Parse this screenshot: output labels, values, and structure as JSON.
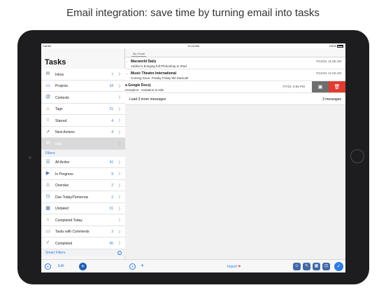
{
  "headline": "Email integration: save time by turning email into tasks",
  "status": {
    "carrier": "Carrier",
    "time": "11:15 AM",
    "battery": "100%"
  },
  "sidebar": {
    "title": "Tasks",
    "items": [
      {
        "label": "Inbox",
        "count": "7",
        "icon": "inbox-icon",
        "glyph": "✉"
      },
      {
        "label": "Projects",
        "count": "34",
        "icon": "folder-icon",
        "glyph": "▭"
      },
      {
        "label": "Contexts",
        "count": "",
        "icon": "at-icon",
        "glyph": "@"
      },
      {
        "label": "Tags",
        "count": "21",
        "icon": "tag-icon",
        "glyph": "⌂"
      },
      {
        "label": "Starred",
        "count": "4",
        "icon": "star-icon",
        "glyph": "☆"
      },
      {
        "label": "Next Actions",
        "count": "4",
        "icon": "arrow-icon",
        "glyph": "➚"
      },
      {
        "label": "Mail",
        "count": "",
        "icon": "mail-icon",
        "glyph": "✉"
      }
    ],
    "filters_header": "Filters",
    "filters": [
      {
        "label": "All Active",
        "count": "41",
        "icon": "all-active-icon",
        "glyph": "☰"
      },
      {
        "label": "In Progress",
        "count": "9",
        "icon": "play-icon",
        "glyph": "▶"
      },
      {
        "label": "Overdue",
        "count": "2",
        "icon": "warning-icon",
        "glyph": "⚠"
      },
      {
        "label": "Due Today/Tomorrow",
        "count": "2",
        "icon": "clock-icon",
        "glyph": "◷"
      },
      {
        "label": "Undated",
        "count": "31",
        "icon": "calendar-icon",
        "glyph": "▦"
      },
      {
        "label": "Completed Today",
        "count": "",
        "icon": "bulb-icon",
        "glyph": "♁"
      },
      {
        "label": "Tasks with Comments",
        "count": "3",
        "icon": "comment-icon",
        "glyph": "▭"
      },
      {
        "label": "Completed",
        "count": "45",
        "icon": "checkmark-icon",
        "glyph": "✓"
      }
    ],
    "smart_filters_header": "Smart Filters",
    "edit_label": "Edit"
  },
  "main": {
    "tab_label": "My Gmail",
    "messages": [
      {
        "title": "Macworld Daily",
        "subtitle": "Adobe is bringing full Photoshop to iPad",
        "date": "7/13/18, 11:56 AM"
      },
      {
        "title": "Music Theatre International",
        "subtitle": "Coming Soon: Freaky Friday the Musical!",
        "date": "7/13/18, 11:03 AM"
      }
    ],
    "swiped": {
      "title": "a Google Docs)",
      "subtitle": "escription - Invitation to edit",
      "date": "7/7/18, 5:55 PM"
    },
    "load_more": "Load 3 more messages",
    "load_count": "3 messages",
    "import_label": "Import"
  },
  "colors": {
    "accent": "#2f7de1",
    "delete": "#e23b30",
    "archive": "#6e6e6e",
    "tool": "#4068a6"
  }
}
